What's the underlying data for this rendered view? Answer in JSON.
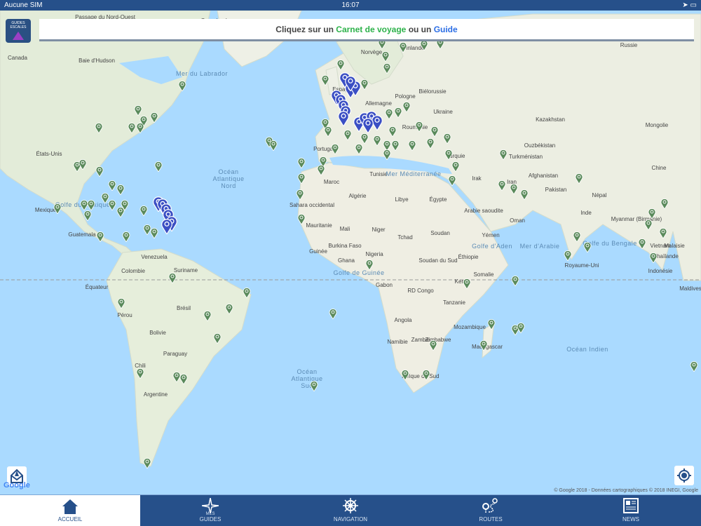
{
  "status": {
    "carrier": "Aucune SIM",
    "time": "16:07"
  },
  "banner": {
    "prefix": "Cliquez sur un ",
    "carnet": "Carnet de voyage",
    "middle": " ou un ",
    "guide": "Guide"
  },
  "logo": {
    "text": "GUIDES ESCALES"
  },
  "map": {
    "google": "Google",
    "copyright": "© Google 2018 - Données cartographiques © 2018 INEGI, Google",
    "labels": [
      "Canada",
      "Baie d'Hudson",
      "Mer du Labrador",
      "Groenland",
      "Passage du Nord-Ouest",
      "États-Unis",
      "Mexique",
      "Golfe du Mexique",
      "Guatemala",
      "Venezuela",
      "Colombie",
      "Suriname",
      "Équateur",
      "Pérou",
      "Brésil",
      "Bolivie",
      "Paraguay",
      "Chili",
      "Argentine",
      "Océan Atlantique Nord",
      "Océan Atlantique Sud",
      "Océan Indien",
      "Maroc",
      "Algérie",
      "Libye",
      "Égypte",
      "Tunisie",
      "Sahara occidental",
      "Mauritanie",
      "Mali",
      "Niger",
      "Tchad",
      "Soudan",
      "Burkina Faso",
      "Nigeria",
      "Guinée",
      "Ghana",
      "Soudan du Sud",
      "Éthiopie",
      "Somalie",
      "Gabon",
      "RD Congo",
      "Kenya",
      "Tanzanie",
      "Angola",
      "Zambie",
      "Mozambique",
      "Zimbabwe",
      "Namibie",
      "Madagascar",
      "Afrique du Sud",
      "Golfe de Guinée",
      "Mer Méditerranée",
      "Allemagne",
      "Pologne",
      "Biélorussie",
      "Ukraine",
      "Roumanie",
      "Turquie",
      "Norvège",
      "Finlande",
      "Russie",
      "Kazakhstan",
      "Mongolie",
      "Ouzbékistan",
      "Turkménistan",
      "Iran",
      "Irak",
      "Afghanistan",
      "Pakistan",
      "Népal",
      "Inde",
      "Chine",
      "Arabie saoudite",
      "Oman",
      "Yémen",
      "Golfe d'Aden",
      "Mer d'Arabie",
      "Golfe du Bengale",
      "Myanmar (Birmanie)",
      "Thaïlande",
      "Vietnam",
      "Malaisie",
      "Indonésie",
      "Maldives",
      "Royaume-Uni",
      "Espagne",
      "Portugal"
    ]
  },
  "tabs": [
    {
      "label": "ACCUEIL"
    },
    {
      "sub": "MES",
      "label": "GUIDES"
    },
    {
      "label": "NAVIGATION"
    },
    {
      "label": "ROUTES"
    },
    {
      "label": "NEWS"
    }
  ],
  "colors": {
    "bar": "#26508a",
    "ocean": "#aadaff",
    "land": "#eef0e6",
    "pin_green": "#5a8a5b",
    "pin_blue": "#3b4fc4"
  }
}
